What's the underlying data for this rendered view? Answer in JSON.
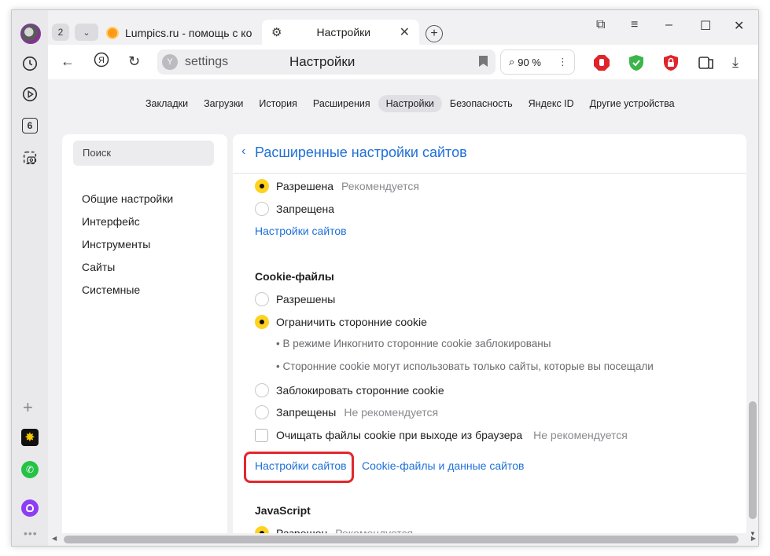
{
  "tabs": {
    "count": "2",
    "tab1_title": "Lumpics.ru - помощь с ко",
    "tab2_title": "Настройки",
    "new_tab": "+"
  },
  "address": {
    "url": "settings",
    "page_title": "Настройки",
    "zoom": "90 %"
  },
  "sidebar": {
    "tabs_badge": "6"
  },
  "settings_nav": [
    "Закладки",
    "Загрузки",
    "История",
    "Расширения",
    "Настройки",
    "Безопасность",
    "Яндекс ID",
    "Другие устройства"
  ],
  "left_menu": {
    "search_placeholder": "Поиск",
    "items": [
      "Общие настройки",
      "Интерфейс",
      "Инструменты",
      "Сайты",
      "Системные"
    ]
  },
  "main": {
    "title": "Расширенные настройки сайтов",
    "top_section": {
      "option_allowed": "Разрешена",
      "option_allowed_note": "Рекомендуется",
      "option_denied": "Запрещена",
      "link_site_settings": "Настройки сайтов"
    },
    "cookies": {
      "heading": "Cookie-файлы",
      "opt_allowed": "Разрешены",
      "opt_limit": "Ограничить сторонние cookie",
      "bullet1": "• В режиме Инкогнито сторонние cookie заблокированы",
      "bullet2": "• Сторонние cookie могут использовать только сайты, которые вы посещали",
      "opt_block": "Заблокировать сторонние cookie",
      "opt_denied": "Запрещены",
      "opt_denied_note": "Не рекомендуется",
      "clear_on_exit": "Очищать файлы cookie при выходе из браузера",
      "clear_on_exit_note": "Не рекомендуется",
      "link_site_settings": "Настройки сайтов",
      "link_cookie_data": "Cookie-файлы и данные сайтов"
    },
    "javascript": {
      "heading": "JavaScript",
      "opt_allowed": "Разрешен",
      "opt_allowed_note": "Рекомендуется"
    }
  },
  "colors": {
    "accent_link": "#1e6fd9",
    "radio_selected": "#ffd21e",
    "highlight_box": "#e3262e"
  }
}
